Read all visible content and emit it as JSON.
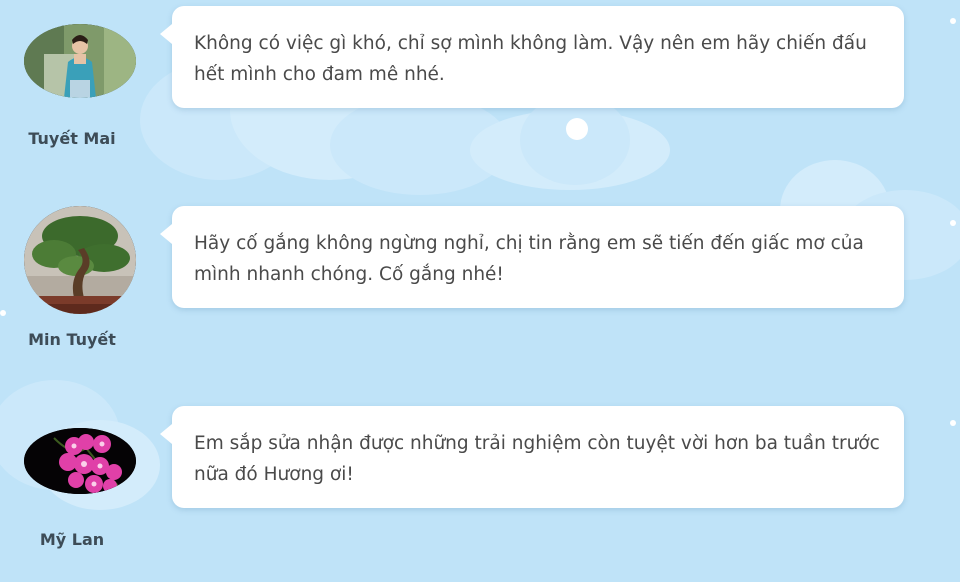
{
  "colors": {
    "background": "#bfe3f8",
    "bubble": "#ffffff",
    "text": "#4a4a4a",
    "name": "#3d4c57"
  },
  "comments": [
    {
      "author": "Tuyết Mai",
      "avatar_icon": "woman-portrait-photo",
      "text": "Không có việc gì khó, chỉ sợ mình không làm. Vậy nên em hãy chiến đấu hết mình cho đam mê nhé."
    },
    {
      "author": "Min Tuyết",
      "avatar_icon": "bonsai-tree-photo",
      "text": "Hãy cố gắng không ngừng nghỉ, chị tin rằng em sẽ tiến đến giấc mơ của mình nhanh chóng. Cố gắng nhé!"
    },
    {
      "author": "Mỹ Lan",
      "avatar_icon": "pink-orchid-photo",
      "text": "Em sắp sửa nhận được những trải nghiệm còn tuyệt vời hơn ba tuần trước nữa đó Hương ơi!"
    }
  ]
}
